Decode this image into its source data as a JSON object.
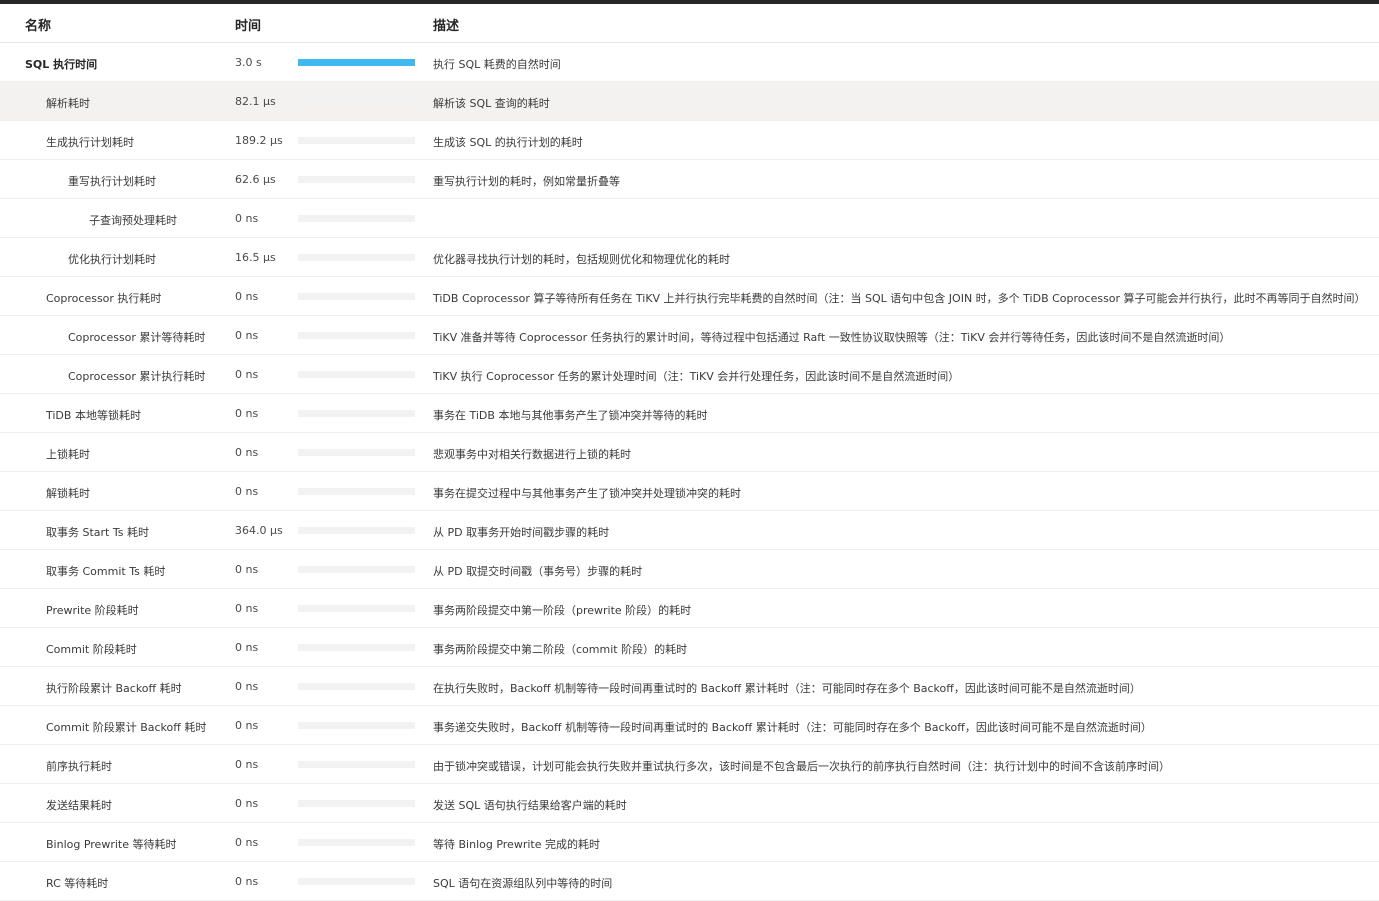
{
  "header": {
    "name": "名称",
    "time": "时间",
    "desc": "描述"
  },
  "colors": {
    "bar_fill": "#3fb7ef",
    "bar_track": "#f2f2f2",
    "selected_row": "#f3f2f1"
  },
  "rows": [
    {
      "name": "SQL 执行时间",
      "time": "3.0 s",
      "progress": 1.0,
      "desc": "执行 SQL 耗费的自然时间",
      "level": 0,
      "bold": true
    },
    {
      "name": "解析耗时",
      "time": "82.1 μs",
      "progress": 0.0,
      "desc": "解析该 SQL 查询的耗时",
      "level": 1,
      "selected": true
    },
    {
      "name": "生成执行计划耗时",
      "time": "189.2 μs",
      "progress": 0.0,
      "desc": "生成该 SQL 的执行计划的耗时",
      "level": 1
    },
    {
      "name": "重写执行计划耗时",
      "time": "62.6 μs",
      "progress": 0.0,
      "desc": "重写执行计划的耗时，例如常量折叠等",
      "level": 2
    },
    {
      "name": "子查询预处理耗时",
      "time": "0 ns",
      "progress": 0.0,
      "desc": "",
      "level": 3
    },
    {
      "name": "优化执行计划耗时",
      "time": "16.5 μs",
      "progress": 0.0,
      "desc": "优化器寻找执行计划的耗时，包括规则优化和物理优化的耗时",
      "level": 2
    },
    {
      "name": "Coprocessor 执行耗时",
      "time": "0 ns",
      "progress": 0.0,
      "desc": "TiDB Coprocessor 算子等待所有任务在 TiKV 上并行执行完毕耗费的自然时间（注：当 SQL 语句中包含 JOIN 时，多个 TiDB Coprocessor 算子可能会并行执行，此时不再等同于自然时间）",
      "level": 1
    },
    {
      "name": "Coprocessor 累计等待耗时",
      "time": "0 ns",
      "progress": 0.0,
      "desc": "TiKV 准备并等待 Coprocessor 任务执行的累计时间，等待过程中包括通过 Raft 一致性协议取快照等（注：TiKV 会并行等待任务，因此该时间不是自然流逝时间）",
      "level": 2
    },
    {
      "name": "Coprocessor 累计执行耗时",
      "time": "0 ns",
      "progress": 0.0,
      "desc": "TiKV 执行 Coprocessor 任务的累计处理时间（注：TiKV 会并行处理任务，因此该时间不是自然流逝时间）",
      "level": 2
    },
    {
      "name": "TiDB 本地等锁耗时",
      "time": "0 ns",
      "progress": 0.0,
      "desc": "事务在 TiDB 本地与其他事务产生了锁冲突并等待的耗时",
      "level": 1
    },
    {
      "name": "上锁耗时",
      "time": "0 ns",
      "progress": 0.0,
      "desc": "悲观事务中对相关行数据进行上锁的耗时",
      "level": 1
    },
    {
      "name": "解锁耗时",
      "time": "0 ns",
      "progress": 0.0,
      "desc": "事务在提交过程中与其他事务产生了锁冲突并处理锁冲突的耗时",
      "level": 1
    },
    {
      "name": "取事务 Start Ts 耗时",
      "time": "364.0 μs",
      "progress": 0.0,
      "desc": "从 PD 取事务开始时间戳步骤的耗时",
      "level": 1
    },
    {
      "name": "取事务 Commit Ts 耗时",
      "time": "0 ns",
      "progress": 0.0,
      "desc": "从 PD 取提交时间戳（事务号）步骤的耗时",
      "level": 1
    },
    {
      "name": "Prewrite 阶段耗时",
      "time": "0 ns",
      "progress": 0.0,
      "desc": "事务两阶段提交中第一阶段（prewrite 阶段）的耗时",
      "level": 1
    },
    {
      "name": "Commit 阶段耗时",
      "time": "0 ns",
      "progress": 0.0,
      "desc": "事务两阶段提交中第二阶段（commit 阶段）的耗时",
      "level": 1
    },
    {
      "name": "执行阶段累计 Backoff 耗时",
      "time": "0 ns",
      "progress": 0.0,
      "desc": "在执行失败时，Backoff 机制等待一段时间再重试时的 Backoff 累计耗时（注：可能同时存在多个 Backoff，因此该时间可能不是自然流逝时间）",
      "level": 1
    },
    {
      "name": "Commit 阶段累计 Backoff 耗时",
      "time": "0 ns",
      "progress": 0.0,
      "desc": "事务递交失败时，Backoff 机制等待一段时间再重试时的 Backoff 累计耗时（注：可能同时存在多个 Backoff，因此该时间可能不是自然流逝时间）",
      "level": 1
    },
    {
      "name": "前序执行耗时",
      "time": "0 ns",
      "progress": 0.0,
      "desc": "由于锁冲突或错误，计划可能会执行失败并重试执行多次，该时间是不包含最后一次执行的前序执行自然时间（注：执行计划中的时间不含该前序时间）",
      "level": 1
    },
    {
      "name": "发送结果耗时",
      "time": "0 ns",
      "progress": 0.0,
      "desc": "发送 SQL 语句执行结果给客户端的耗时",
      "level": 1
    },
    {
      "name": "Binlog Prewrite 等待耗时",
      "time": "0 ns",
      "progress": 0.0,
      "desc": "等待 Binlog Prewrite 完成的耗时",
      "level": 1
    },
    {
      "name": "RC 等待耗时",
      "time": "0 ns",
      "progress": 0.0,
      "desc": "SQL 语句在资源组队列中等待的时间",
      "level": 1
    }
  ]
}
